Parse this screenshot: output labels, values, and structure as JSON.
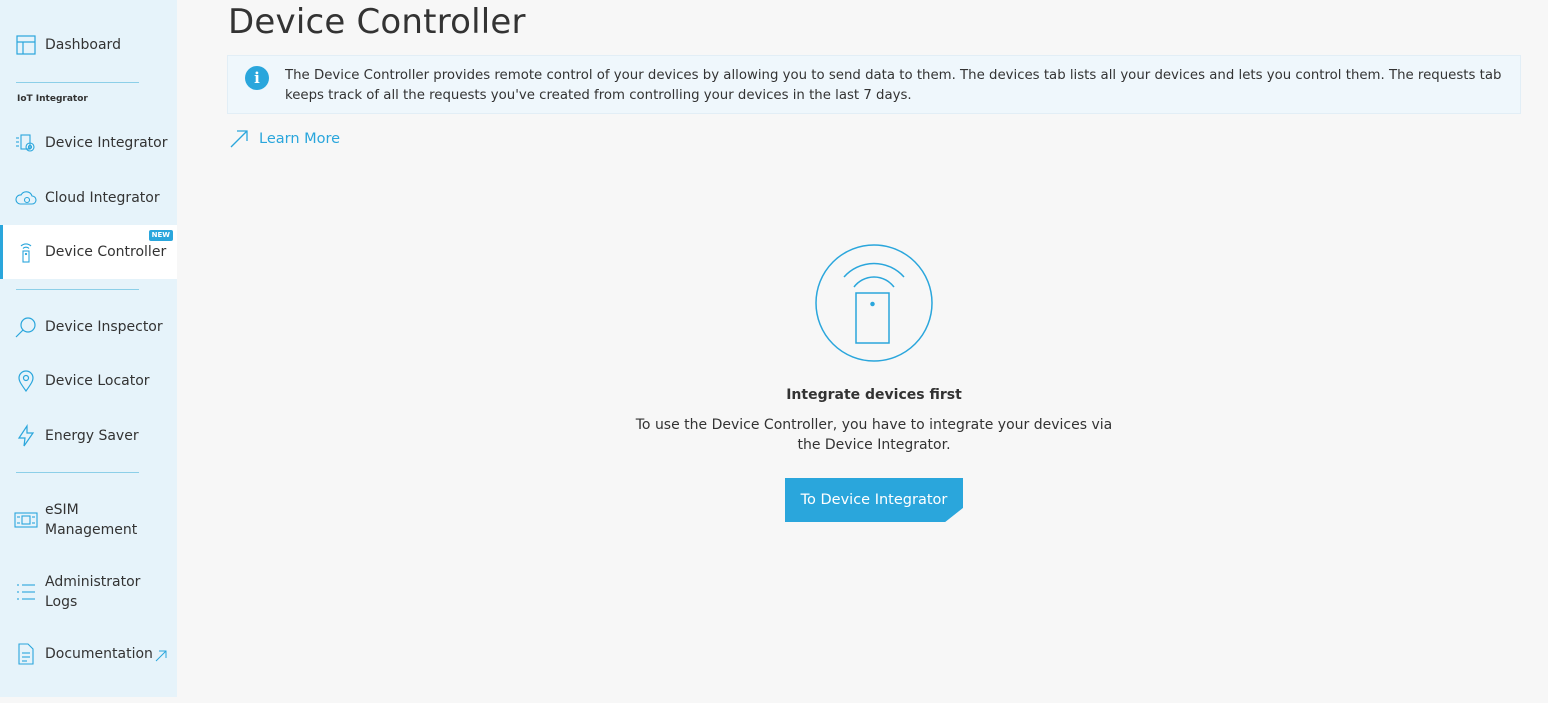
{
  "sidebar": {
    "section_label": "IoT Integrator",
    "items": [
      {
        "id": "dashboard",
        "label": "Dashboard",
        "icon": "dashboard-icon"
      },
      {
        "id": "device-integrator",
        "label": "Device Integrator",
        "icon": "device-integrator-icon"
      },
      {
        "id": "cloud-integrator",
        "label": "Cloud Integrator",
        "icon": "cloud-integrator-icon"
      },
      {
        "id": "device-controller",
        "label": "Device Controller",
        "icon": "remote-control-icon",
        "badge": "NEW",
        "active": true
      },
      {
        "id": "device-inspector",
        "label": "Device Inspector",
        "icon": "magnifier-icon"
      },
      {
        "id": "device-locator",
        "label": "Device Locator",
        "icon": "location-pin-icon"
      },
      {
        "id": "energy-saver",
        "label": "Energy Saver",
        "icon": "lightning-icon"
      },
      {
        "id": "esim-management",
        "label": "eSIM Management",
        "icon": "esim-icon"
      },
      {
        "id": "administrator-logs",
        "label": "Administrator Logs",
        "icon": "list-icon"
      },
      {
        "id": "documentation",
        "label": "Documentation",
        "icon": "document-icon",
        "external": true
      }
    ]
  },
  "main": {
    "title": "Device Controller",
    "info": "The Device Controller provides remote control of your devices by allowing you to send data to them. The devices tab lists all your devices and lets you control them. The requests tab keeps track of all the requests you've created from controlling your devices in the last 7 days.",
    "learn_more": "Learn More",
    "empty_state": {
      "title": "Integrate devices first",
      "text": "To use the Device Controller, you have to integrate your devices via the Device Integrator.",
      "button": "To Device Integrator"
    }
  },
  "colors": {
    "accent": "#2aa6dc",
    "sidebar_bg": "#e6f3fa",
    "page_bg": "#f7f7f7"
  }
}
